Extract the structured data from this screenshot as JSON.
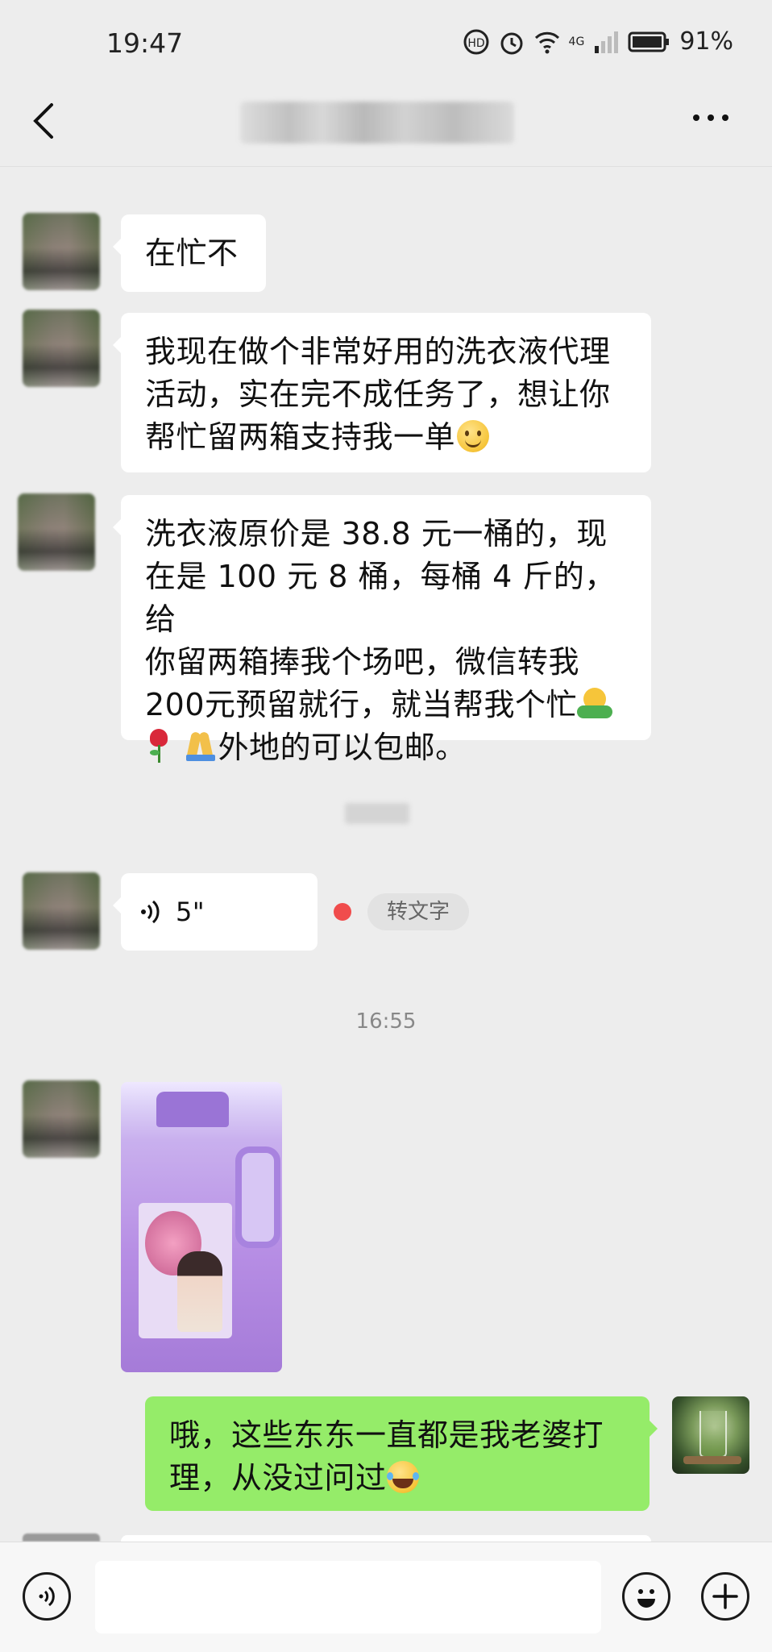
{
  "status_bar": {
    "time": "19:47",
    "network": "4G",
    "battery": "91%"
  },
  "header": {
    "contact_name": "",
    "more_label": "···"
  },
  "messages": [
    {
      "type": "text",
      "side": "left",
      "text": "在忙不"
    },
    {
      "type": "text",
      "side": "left",
      "lines": [
        "我现在做个非常好用的洗衣液代理",
        "活动，实在完不成任务了，想让你",
        "帮忙留两箱支持我一单"
      ]
    },
    {
      "type": "text",
      "side": "left",
      "lines": [
        "洗衣液原价是 38.8 元一桶的，现",
        "在是 100 元 8 桶，每桶 4 斤的，给",
        "你留两箱捧我个场吧，微信转我",
        "200元预留就行，就当帮我个忙",
        "外地的可以包邮。"
      ]
    },
    {
      "type": "voice",
      "side": "left",
      "duration": "5\"",
      "transcribe_label": "转文字"
    },
    {
      "type": "image",
      "side": "left",
      "subject": "purple laundry detergent bottle"
    },
    {
      "type": "text",
      "side": "right",
      "lines": [
        "哦，这些东东一直都是我老婆打",
        "理，从没过问过"
      ]
    }
  ],
  "timestamp": "16:55",
  "colors": {
    "chat_bg": "#ededed",
    "bubble_left": "#ffffff",
    "bubble_right": "#95ec69",
    "unread_dot": "#f04c4c"
  },
  "input_bar": {
    "voice_icon": "voice-mode-icon",
    "emoji_icon": "emoji-icon",
    "plus_icon": "plus-icon"
  }
}
